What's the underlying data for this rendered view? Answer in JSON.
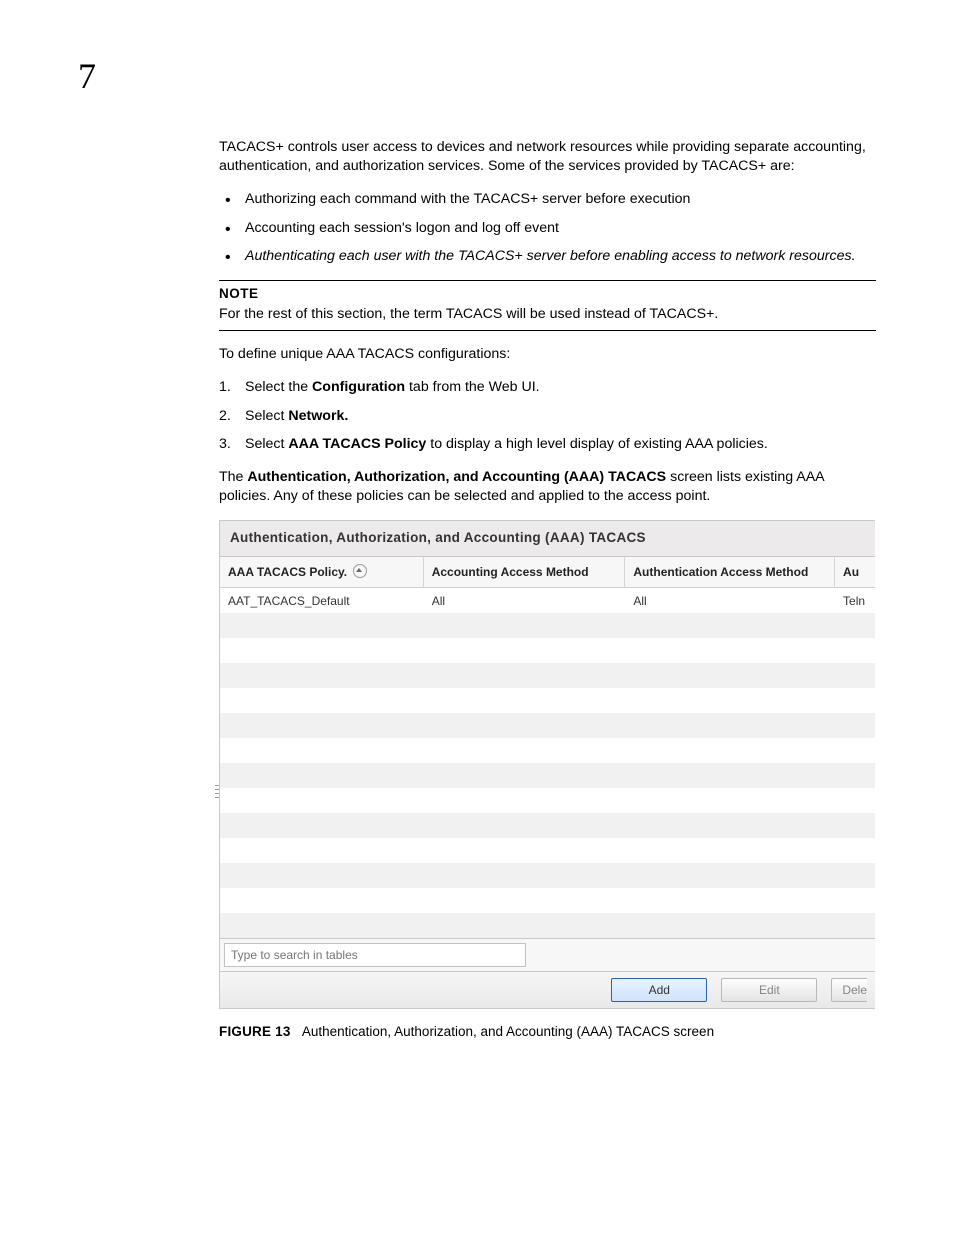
{
  "chapter_number": "7",
  "intro_para": "TACACS+ controls user access to devices and network resources while providing separate accounting, authentication, and authorization services. Some of the services provided by TACACS+ are:",
  "bullets": [
    {
      "text": "Authorizing each command with the TACACS+ server before execution",
      "italic": false
    },
    {
      "text": "Accounting each session's logon and log off event",
      "italic": false
    },
    {
      "text": "Authenticating each user with the TACACS+ server before enabling access to network resources.",
      "italic": true
    }
  ],
  "note_label": "NOTE",
  "note_text": "For the rest of this section, the term TACACS will be used instead of TACACS+.",
  "lead_in": "To define unique AAA TACACS configurations:",
  "steps": [
    {
      "pre": "Select the ",
      "bold": "Configuration",
      "post": " tab from the Web UI."
    },
    {
      "pre": "Select ",
      "bold": "Network.",
      "post": ""
    },
    {
      "pre": "Select ",
      "bold": "AAA TACACS Policy",
      "post": " to display a high level display of existing AAA policies."
    }
  ],
  "result_para": {
    "pre": "The ",
    "bold": "Authentication, Authorization, and Accounting (AAA) TACACS",
    "post": " screen lists existing AAA policies. Any of these policies can be selected and applied to the access point."
  },
  "screenshot": {
    "title": "Authentication, Authorization, and Accounting (AAA) TACACS",
    "columns": [
      "AAA TACACS Policy",
      "Accounting Access Method",
      "Authentication Access Method",
      "Au"
    ],
    "sort_column_index": 0,
    "rows": [
      {
        "policy": "AAT_TACACS_Default",
        "accounting": "All",
        "authentication": "All",
        "partial": "Teln"
      }
    ],
    "empty_row_count": 13,
    "search_placeholder": "Type to search in tables",
    "buttons": {
      "add": "Add",
      "edit": "Edit",
      "delete": "Dele"
    }
  },
  "caption": {
    "label": "FIGURE 13",
    "text": "Authentication, Authorization, and Accounting (AAA) TACACS screen"
  }
}
